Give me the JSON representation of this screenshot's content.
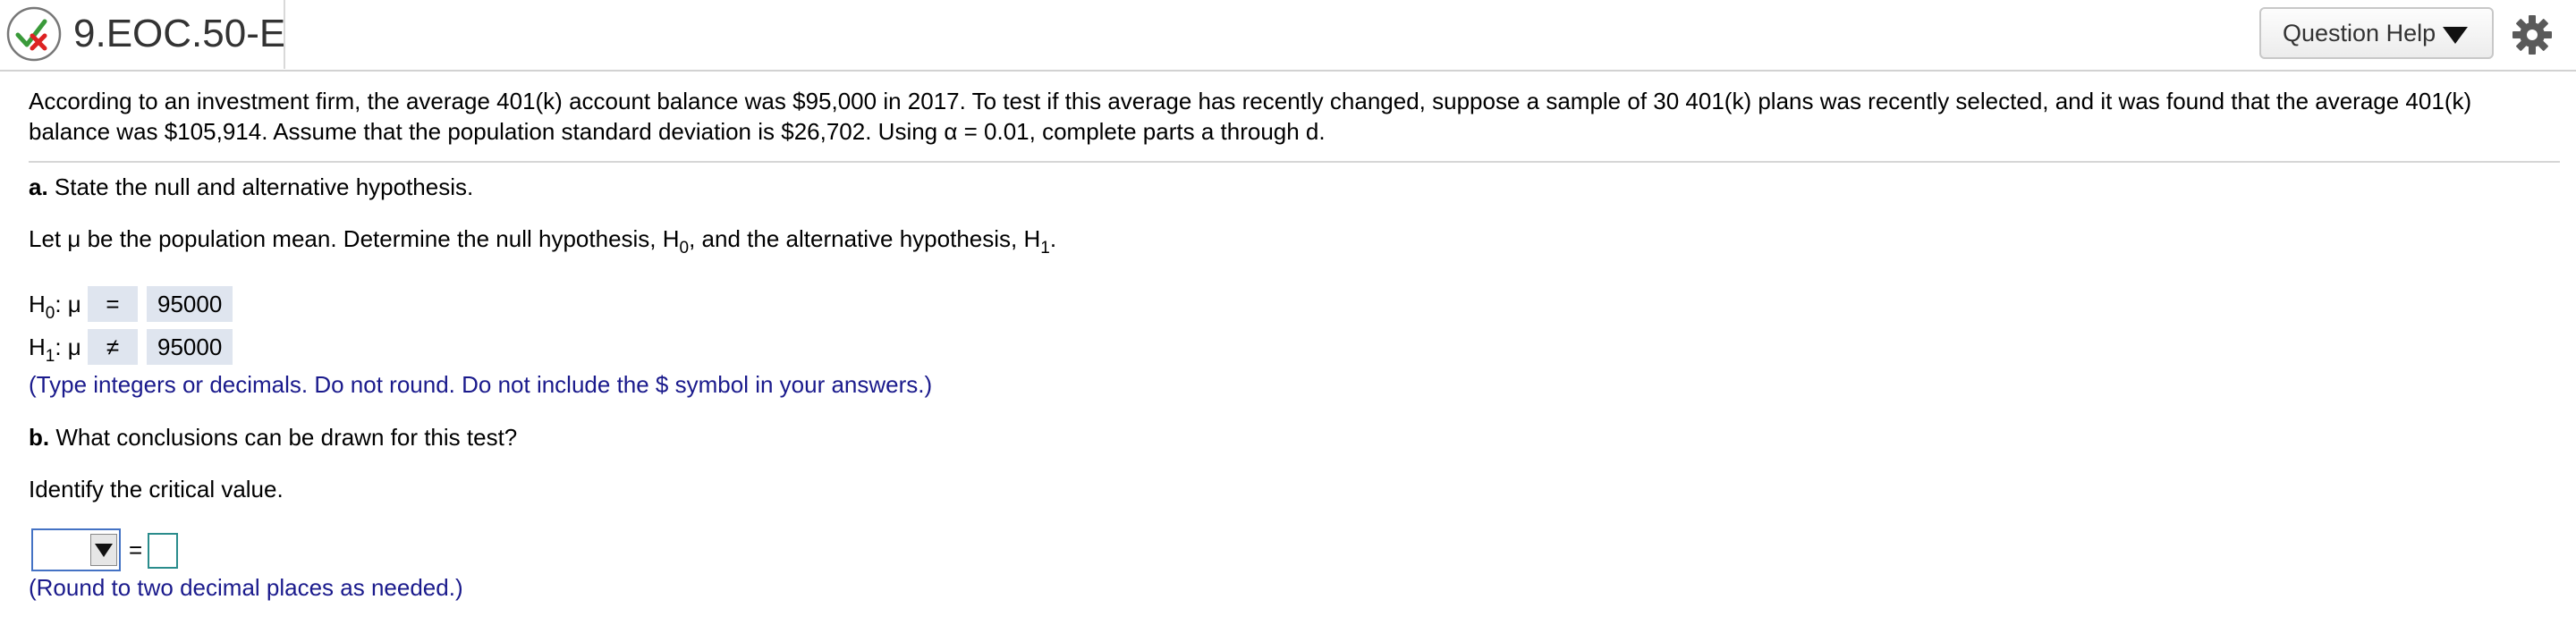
{
  "header": {
    "title": "9.EOC.50-E",
    "question_help_label": "Question Help",
    "status_icon": "partially-correct-icon",
    "settings_icon": "gear-icon"
  },
  "problem": {
    "line1": "According to an investment firm, the average 401(k) account balance was $95,000 in 2017. To test if this average has recently changed, suppose a sample of 30 401(k) plans was recently selected, and it was found that the average 401(k)",
    "line2": "balance was $105,914. Assume that the population standard deviation is $26,702. Using α = 0.01, complete parts a through d."
  },
  "part_a": {
    "label": "a.",
    "text": " State the null and alternative hypothesis.",
    "instruction_pre": "Let μ be the population mean. Determine the null hypothesis, H",
    "instruction_sub0": "0",
    "instruction_mid": ", and the alternative hypothesis, H",
    "instruction_sub1": "1",
    "instruction_post": ".",
    "h0": {
      "h": "H",
      "sub": "0",
      "rest": ": μ",
      "symbol": "=",
      "value": "95000"
    },
    "h1": {
      "h": "H",
      "sub": "1",
      "rest": ": μ",
      "symbol": "≠",
      "value": "95000"
    },
    "hint": "(Type integers or decimals. Do not round. Do not include the $ symbol in your answers.)"
  },
  "part_b": {
    "label": "b.",
    "text": " What conclusions can be drawn for this test?",
    "instruction": "Identify the critical value.",
    "select_value": "",
    "equals": "=",
    "answer_value": "",
    "hint": "(Round to two decimal places as needed.)"
  },
  "colors": {
    "hint_text": "#1a1a8c",
    "answer_fill": "#dfe5ef",
    "select_border": "#4472c4",
    "input_border": "#2a8c8c"
  }
}
